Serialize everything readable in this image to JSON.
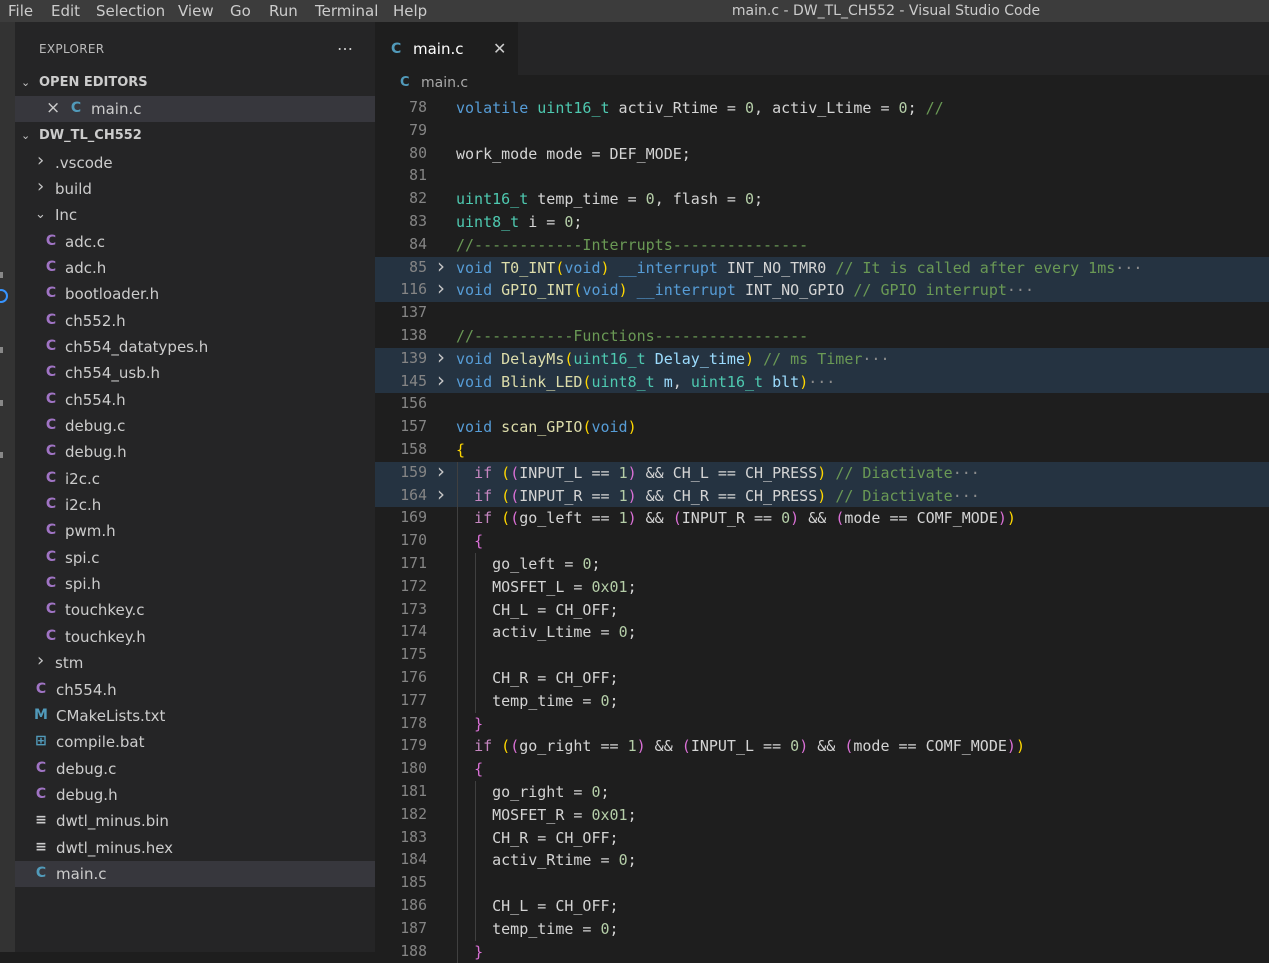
{
  "window": {
    "title": "main.c - DW_TL_CH552 - Visual Studio Code"
  },
  "menu": [
    "File",
    "Edit",
    "Selection",
    "View",
    "Go",
    "Run",
    "Terminal",
    "Help"
  ],
  "explorer": {
    "title": "EXPLORER",
    "more_icon": "…",
    "open_editors_label": "OPEN EDITORS",
    "open_editor": {
      "name": "main.c",
      "close_icon": "×"
    },
    "project_label": "DW_TL_CH552",
    "tree": [
      {
        "name": ".vscode",
        "type": "folder"
      },
      {
        "name": "build",
        "type": "folder"
      },
      {
        "name": "Inc",
        "type": "folder-open"
      },
      {
        "name": "adc.c",
        "type": "c"
      },
      {
        "name": "adc.h",
        "type": "c"
      },
      {
        "name": "bootloader.h",
        "type": "c"
      },
      {
        "name": "ch552.h",
        "type": "c"
      },
      {
        "name": "ch554_datatypes.h",
        "type": "c"
      },
      {
        "name": "ch554_usb.h",
        "type": "c"
      },
      {
        "name": "ch554.h",
        "type": "c"
      },
      {
        "name": "debug.c",
        "type": "c"
      },
      {
        "name": "debug.h",
        "type": "c"
      },
      {
        "name": "i2c.c",
        "type": "c"
      },
      {
        "name": "i2c.h",
        "type": "c"
      },
      {
        "name": "pwm.h",
        "type": "c"
      },
      {
        "name": "spi.c",
        "type": "c"
      },
      {
        "name": "spi.h",
        "type": "c"
      },
      {
        "name": "touchkey.c",
        "type": "c"
      },
      {
        "name": "touchkey.h",
        "type": "c"
      },
      {
        "name": "stm",
        "type": "folder"
      },
      {
        "name": "ch554.h",
        "type": "c"
      },
      {
        "name": "CMakeLists.txt",
        "type": "m"
      },
      {
        "name": "compile.bat",
        "type": "win"
      },
      {
        "name": "debug.c",
        "type": "c"
      },
      {
        "name": "debug.h",
        "type": "c"
      },
      {
        "name": "dwtl_minus.bin",
        "type": "txt"
      },
      {
        "name": "dwtl_minus.hex",
        "type": "txt"
      },
      {
        "name": "main.c",
        "type": "cpp"
      }
    ]
  },
  "editor": {
    "tab": {
      "label": "main.c",
      "close_icon": "✕"
    },
    "breadcrumb": "main.c",
    "lines": [
      {
        "n": "78",
        "text": "volatile uint16_t activ_Rtime = 0, activ_Ltime = 0; //"
      },
      {
        "n": "79",
        "text": ""
      },
      {
        "n": "80",
        "text": "work_mode mode = DEF_MODE;"
      },
      {
        "n": "81",
        "text": ""
      },
      {
        "n": "82",
        "text": "uint16_t temp_time = 0, flash = 0;"
      },
      {
        "n": "83",
        "text": "uint8_t i = 0;"
      },
      {
        "n": "84",
        "text": "//------------Interrupts---------------"
      },
      {
        "n": "85",
        "text": "void T0_INT(void) __interrupt INT_NO_TMR0 // It is called after every 1ms···"
      },
      {
        "n": "116",
        "text": "void GPIO_INT(void) __interrupt INT_NO_GPIO // GPIO interrupt···"
      },
      {
        "n": "137",
        "text": ""
      },
      {
        "n": "138",
        "text": "//-----------Functions-----------------"
      },
      {
        "n": "139",
        "text": "void DelayMs(uint16_t Delay_time) // ms Timer···"
      },
      {
        "n": "145",
        "text": "void Blink_LED(uint8_t m, uint16_t blt)···"
      },
      {
        "n": "156",
        "text": ""
      },
      {
        "n": "157",
        "text": "void scan_GPIO(void)"
      },
      {
        "n": "158",
        "text": "{"
      },
      {
        "n": "159",
        "text": "  if ((INPUT_L == 1) && CH_L == CH_PRESS) // Diactivate···"
      },
      {
        "n": "164",
        "text": "  if ((INPUT_R == 1) && CH_R == CH_PRESS) // Diactivate···"
      },
      {
        "n": "169",
        "text": "  if ((go_left == 1) && (INPUT_R == 0) && (mode == COMF_MODE))"
      },
      {
        "n": "170",
        "text": "  {"
      },
      {
        "n": "171",
        "text": "    go_left = 0;"
      },
      {
        "n": "172",
        "text": "    MOSFET_L = 0x01;"
      },
      {
        "n": "173",
        "text": "    CH_L = CH_OFF;"
      },
      {
        "n": "174",
        "text": "    activ_Ltime = 0;"
      },
      {
        "n": "175",
        "text": ""
      },
      {
        "n": "176",
        "text": "    CH_R = CH_OFF;"
      },
      {
        "n": "177",
        "text": "    temp_time = 0;"
      },
      {
        "n": "178",
        "text": "  }"
      },
      {
        "n": "179",
        "text": "  if ((go_right == 1) && (INPUT_L == 0) && (mode == COMF_MODE))"
      },
      {
        "n": "180",
        "text": "  {"
      },
      {
        "n": "181",
        "text": "    go_right = 0;"
      },
      {
        "n": "182",
        "text": "    MOSFET_R = 0x01;"
      },
      {
        "n": "183",
        "text": "    CH_R = CH_OFF;"
      },
      {
        "n": "184",
        "text": "    activ_Rtime = 0;"
      },
      {
        "n": "185",
        "text": ""
      },
      {
        "n": "186",
        "text": "    CH_L = CH_OFF;"
      },
      {
        "n": "187",
        "text": "    temp_time = 0;"
      },
      {
        "n": "188",
        "text": "  }"
      }
    ]
  },
  "colors": {
    "editor_bg": "#1e1e1e",
    "sidebar_bg": "#252526",
    "menubar_bg": "#3c3c3c",
    "keyword": "#569cd6",
    "type": "#4ec9b0",
    "function": "#dcdcaa",
    "number": "#b5cea8",
    "comment": "#6a9955"
  }
}
